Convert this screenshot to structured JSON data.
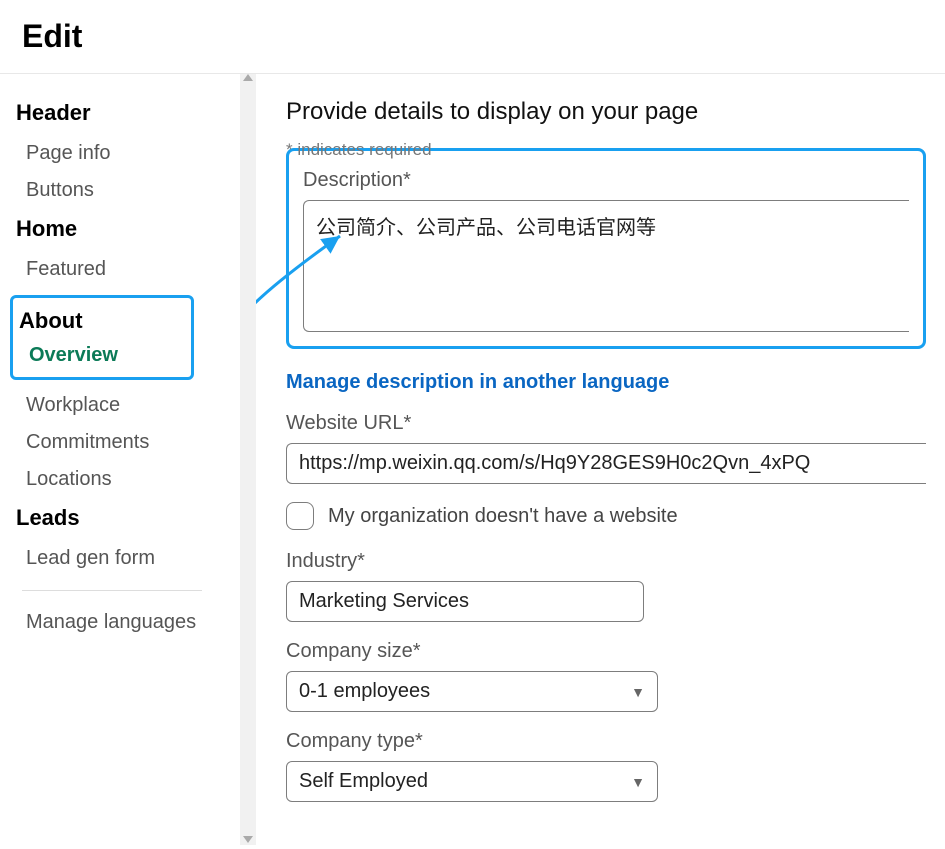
{
  "pageTitle": "Edit",
  "sidebar": {
    "headerGroup": {
      "title": "Header",
      "items": [
        "Page info",
        "Buttons"
      ]
    },
    "homeGroup": {
      "title": "Home",
      "items": [
        "Featured"
      ]
    },
    "aboutGroup": {
      "title": "About",
      "active": "Overview",
      "items": [
        "Workplace",
        "Commitments",
        "Locations"
      ]
    },
    "leadsGroup": {
      "title": "Leads",
      "items": [
        "Lead gen form"
      ]
    },
    "footer": "Manage languages"
  },
  "main": {
    "heading": "Provide details to display on your page",
    "requiredNote": "* indicates required",
    "description": {
      "label": "Description*",
      "value": "公司简介、公司产品、公司电话官网等"
    },
    "manageLangLink": "Manage description in another language",
    "websiteUrl": {
      "label": "Website URL*",
      "value": "https://mp.weixin.qq.com/s/Hq9Y28GES9H0c2Qvn_4xPQ"
    },
    "noWebsite": {
      "label": "My organization doesn't have a website"
    },
    "industry": {
      "label": "Industry*",
      "value": "Marketing Services"
    },
    "companySize": {
      "label": "Company size*",
      "value": "0-1 employees"
    },
    "companyType": {
      "label": "Company type*",
      "value": "Self Employed"
    }
  }
}
